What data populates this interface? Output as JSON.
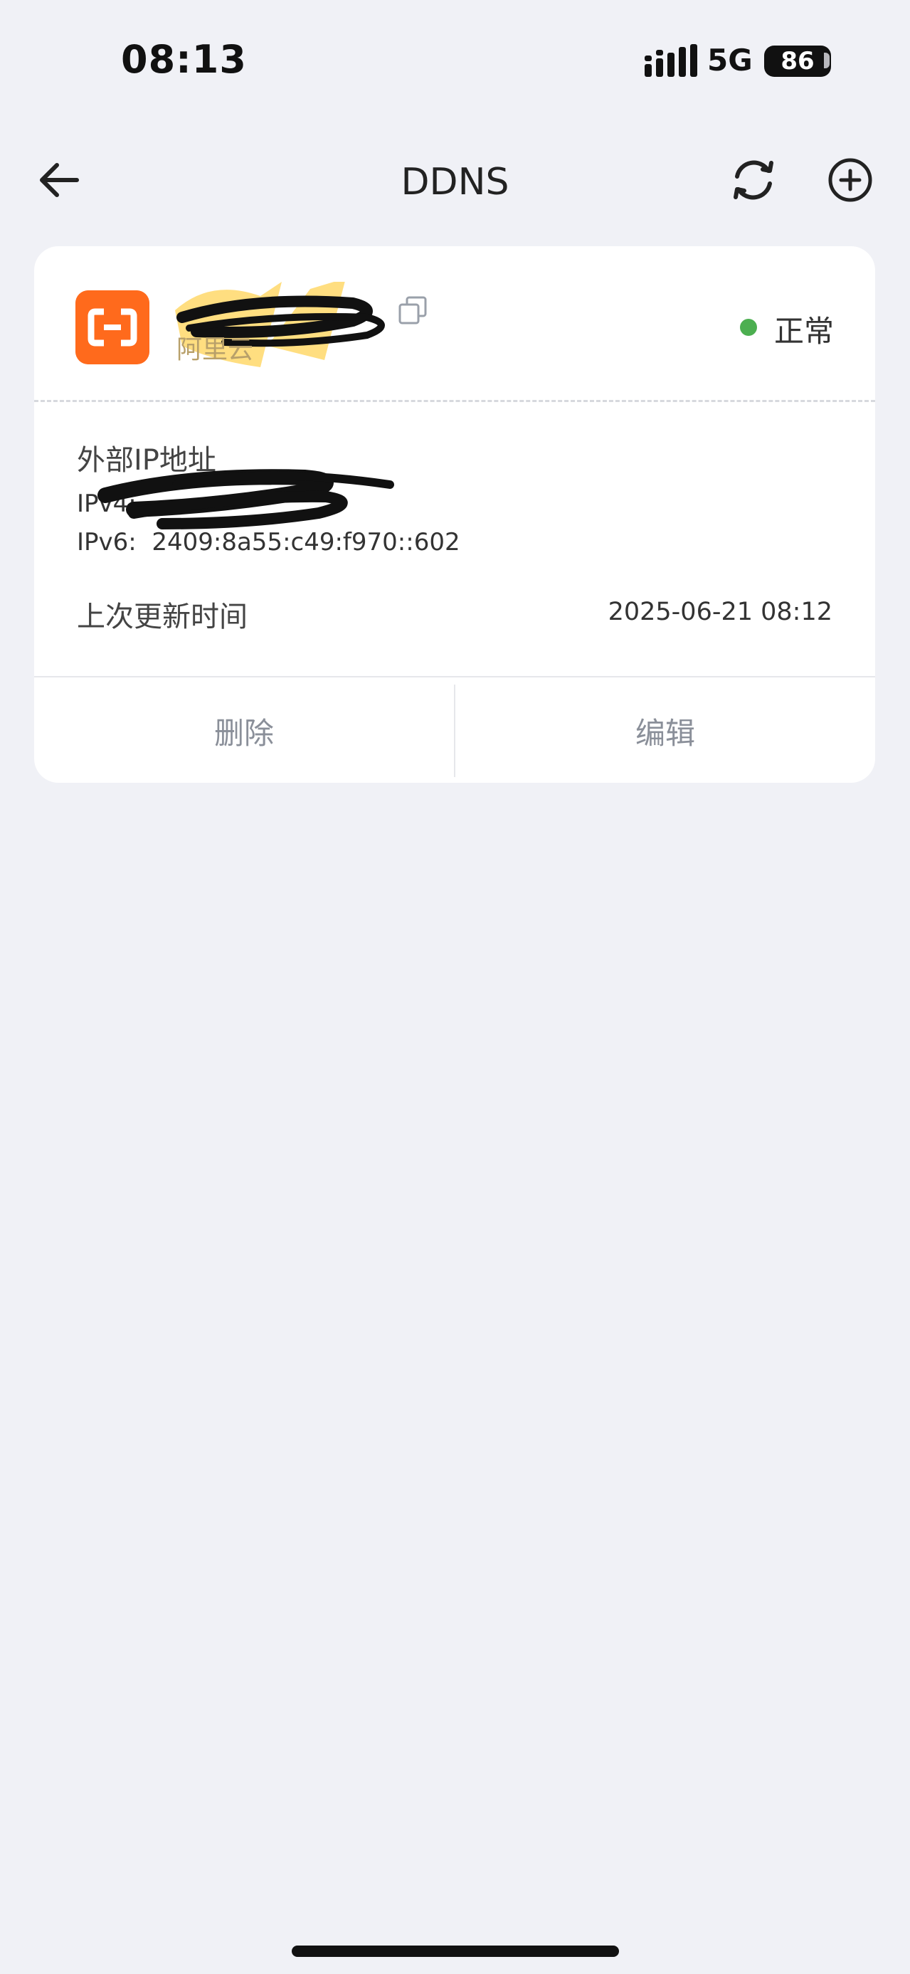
{
  "status_bar": {
    "time": "08:13",
    "network": "5G",
    "battery": "86"
  },
  "nav": {
    "title": "DDNS",
    "back_icon": "arrow-left-icon",
    "refresh_icon": "refresh-icon",
    "add_icon": "plus-circle-icon"
  },
  "record": {
    "provider_name": "阿里云",
    "provider_logo": "aliyun-logo-icon",
    "logo_color": "#ff6a1c",
    "status": "正常",
    "status_color": "#4caf50",
    "external_ip_label": "外部IP地址",
    "ipv4_label": "IPv4:",
    "ipv6_text": "IPv6:  2409:8a55:c49:f970::602",
    "last_update_label": "上次更新时间",
    "last_update_value": "2025-06-21 08:12"
  },
  "actions": {
    "delete": "删除",
    "edit": "编辑"
  }
}
